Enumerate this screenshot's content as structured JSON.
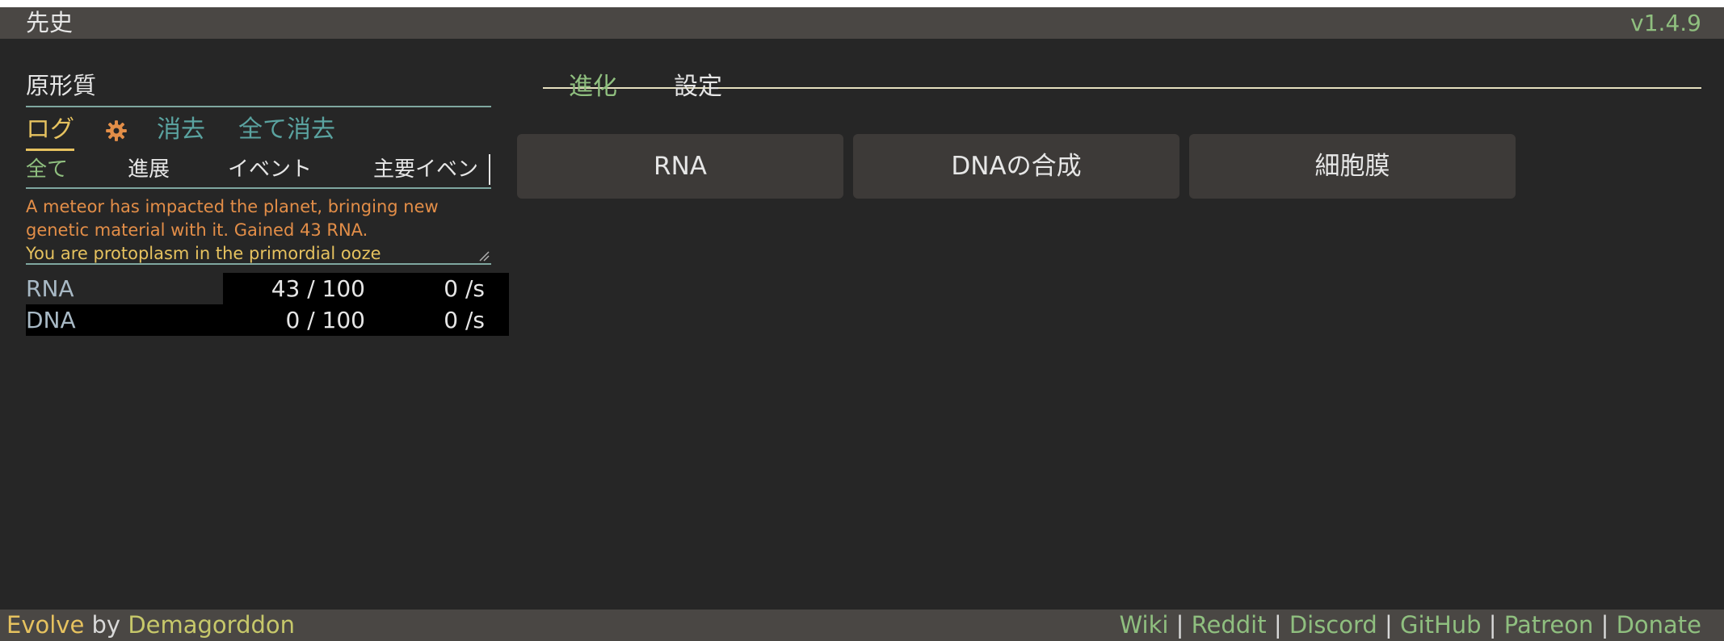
{
  "header": {
    "era": "先史",
    "version": "v1.4.9"
  },
  "race": {
    "name": "原形質"
  },
  "log_tabs": {
    "log": "ログ",
    "settings_icon": "gear-icon",
    "clear": "消去",
    "clear_all": "全て消去"
  },
  "log_filters": {
    "all": "全て",
    "progress": "進展",
    "event": "イベント",
    "major_event": "主要イベン"
  },
  "messages": [
    "A meteor has impacted the planet, bringing new genetic material with it. Gained 43 RNA.",
    "You are protoplasm in the primordial ooze"
  ],
  "resources": [
    {
      "name": "RNA",
      "amount": "43 / 100",
      "rate": "0 /s"
    },
    {
      "name": "DNA",
      "amount": "0 / 100",
      "rate": "0 /s"
    }
  ],
  "main_tabs": {
    "evolution": "進化",
    "settings": "設定"
  },
  "actions": [
    {
      "label": "RNA"
    },
    {
      "label": "DNAの合成"
    },
    {
      "label": "細胞膜"
    }
  ],
  "footer": {
    "game": "Evolve",
    "by": "by",
    "author": "Demagorddon",
    "links": [
      "Wiki",
      "Reddit",
      "Discord",
      "GitHub",
      "Patreon",
      "Donate"
    ],
    "separator": "|"
  },
  "colors": {
    "accent_green": "#8fbf7f",
    "accent_gold": "#e6c25f",
    "accent_teal": "#5aa3a0",
    "log_orange": "#e38e48",
    "panel_bg": "#262626",
    "bar_bg": "#4a4744",
    "button_bg": "#3d3a38"
  }
}
